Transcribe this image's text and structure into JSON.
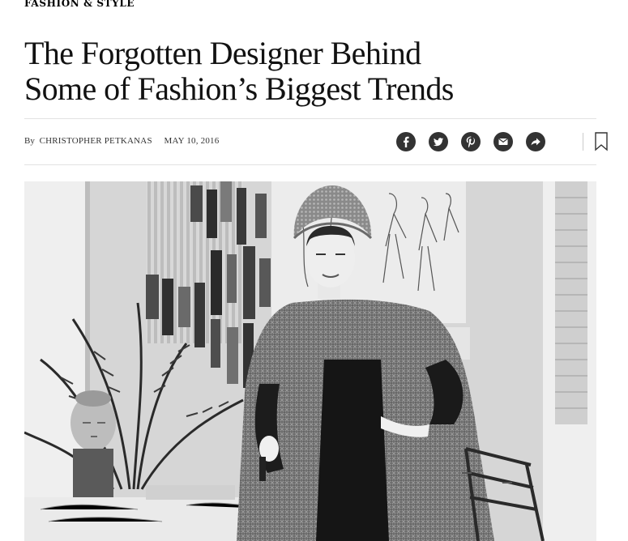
{
  "section": {
    "label": "FASHION & STYLE"
  },
  "headline": {
    "line1": "The Forgotten Designer Behind",
    "line2": "Some of Fashion’s Biggest Trends"
  },
  "byline": {
    "prefix": "By",
    "author": "CHRISTOPHER PETKANAS",
    "date": "MAY 10, 2016"
  },
  "share": {
    "buttons": [
      {
        "name": "facebook",
        "icon": "facebook-icon"
      },
      {
        "name": "twitter",
        "icon": "twitter-icon"
      },
      {
        "name": "pinterest",
        "icon": "pinterest-icon"
      },
      {
        "name": "email",
        "icon": "email-icon"
      },
      {
        "name": "share",
        "icon": "share-arrow-icon"
      }
    ],
    "bookmark_icon": "bookmark-icon"
  },
  "colors": {
    "text": "#121212",
    "share_button": "#333333",
    "rule": "#e2e2e2"
  },
  "photo": {
    "style": "black-and-white"
  }
}
